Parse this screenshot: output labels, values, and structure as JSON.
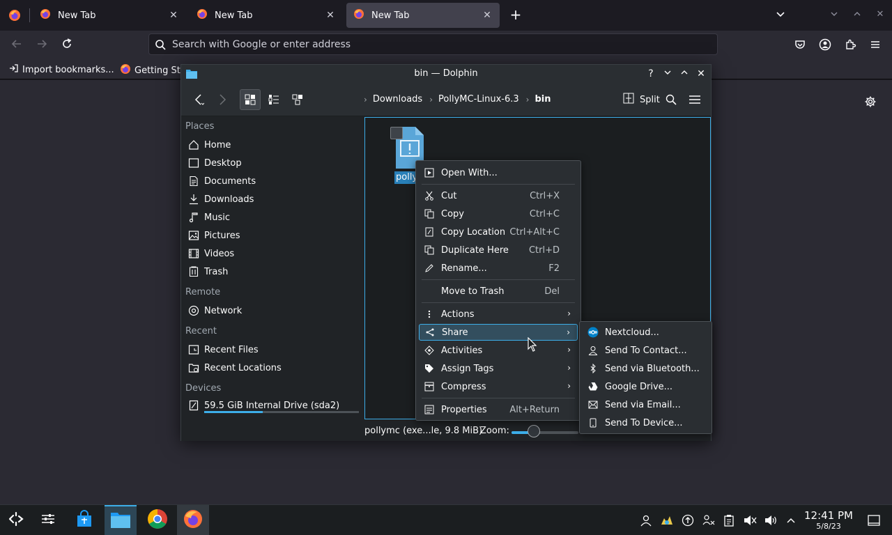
{
  "browser": {
    "tabs": [
      {
        "label": "New Tab"
      },
      {
        "label": "New Tab"
      },
      {
        "label": "New Tab"
      }
    ],
    "urlbar": {
      "placeholder": "Search with Google or enter address"
    },
    "bookmarks": [
      {
        "label": "Import bookmarks..."
      },
      {
        "label": "Getting Sta"
      }
    ]
  },
  "dolphin": {
    "title": "bin — Dolphin",
    "breadcrumb": [
      "Downloads",
      "PollyMC-Linux-6.3",
      "bin"
    ],
    "split_label": "Split",
    "places": {
      "places_header": "Places",
      "items": [
        {
          "label": "Home",
          "icon": "home-icon"
        },
        {
          "label": "Desktop",
          "icon": "desktop-icon"
        },
        {
          "label": "Documents",
          "icon": "documents-icon"
        },
        {
          "label": "Downloads",
          "icon": "downloads-icon"
        },
        {
          "label": "Music",
          "icon": "music-icon"
        },
        {
          "label": "Pictures",
          "icon": "pictures-icon"
        },
        {
          "label": "Videos",
          "icon": "videos-icon"
        },
        {
          "label": "Trash",
          "icon": "trash-icon"
        }
      ],
      "remote_header": "Remote",
      "remote_items": [
        {
          "label": "Network",
          "icon": "network-icon"
        }
      ],
      "recent_header": "Recent",
      "recent_items": [
        {
          "label": "Recent Files",
          "icon": "recent-files-icon"
        },
        {
          "label": "Recent Locations",
          "icon": "recent-locations-icon"
        }
      ],
      "devices_header": "Devices",
      "devices": [
        {
          "label": "59.5 GiB Internal Drive (sda2)",
          "used_fraction": 0.38
        }
      ]
    },
    "file": {
      "name": "polly"
    },
    "status": {
      "text": "pollymc (exe...le, 9.8 MiB)",
      "zoom_label": "Zoom:",
      "zoom_level": 0.33
    }
  },
  "context_menu": {
    "items": [
      {
        "label": "Open With...",
        "shortcut": ""
      },
      {
        "label": "Cut",
        "shortcut": "Ctrl+X"
      },
      {
        "label": "Copy",
        "shortcut": "Ctrl+C"
      },
      {
        "label": "Copy Location",
        "shortcut": "Ctrl+Alt+C"
      },
      {
        "label": "Duplicate Here",
        "shortcut": "Ctrl+D"
      },
      {
        "label": "Rename...",
        "shortcut": "F2"
      },
      {
        "label": "Move to Trash",
        "shortcut": "Del"
      },
      {
        "label": "Actions",
        "shortcut": ""
      },
      {
        "label": "Share",
        "shortcut": ""
      },
      {
        "label": "Activities",
        "shortcut": ""
      },
      {
        "label": "Assign Tags",
        "shortcut": ""
      },
      {
        "label": "Compress",
        "shortcut": ""
      },
      {
        "label": "Properties",
        "shortcut": "Alt+Return"
      }
    ]
  },
  "share_menu": {
    "items": [
      {
        "label": "Nextcloud..."
      },
      {
        "label": "Send To Contact..."
      },
      {
        "label": "Send via Bluetooth..."
      },
      {
        "label": "Google Drive..."
      },
      {
        "label": "Send via Email..."
      },
      {
        "label": "Send To Device..."
      }
    ]
  },
  "taskbar": {
    "time": "12:41 PM",
    "date": "5/8/23"
  },
  "colors": {
    "accent": "#3daee9",
    "highlight": "#334e5e",
    "firefox_orange": "#ff7139"
  }
}
